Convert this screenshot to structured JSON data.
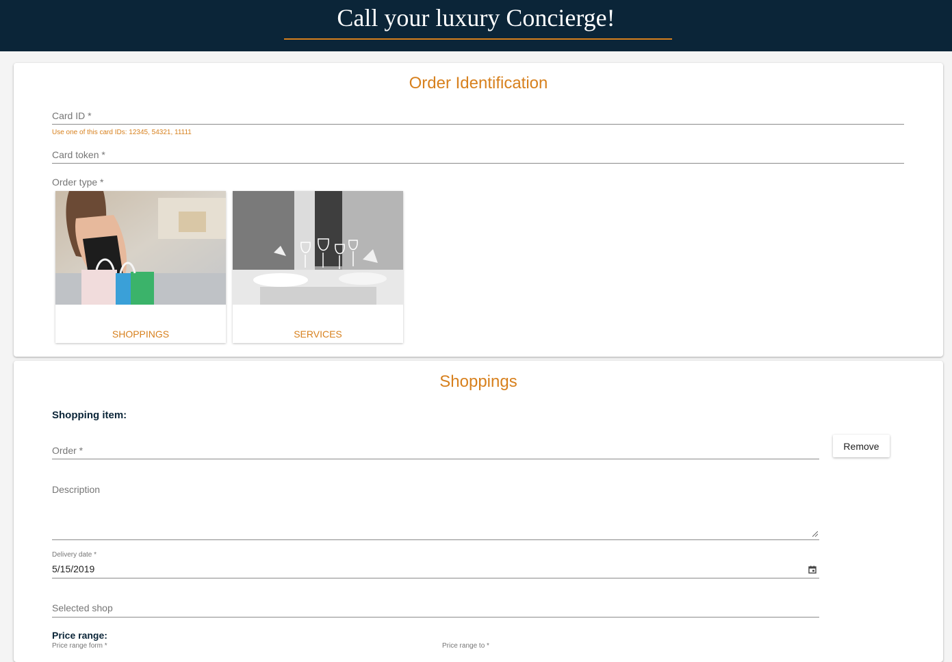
{
  "header": {
    "title": "Call your luxury Concierge!"
  },
  "order_identification": {
    "title": "Order Identification",
    "card_id": {
      "label": "Card ID *",
      "value": "",
      "hint": "Use one of this card IDs: 12345, 54321, 11111"
    },
    "card_token": {
      "label": "Card token *",
      "value": ""
    },
    "order_type": {
      "label": "Order type *",
      "options": [
        {
          "label": "SHOPPINGS",
          "image": "shopping-woman-bags-photo"
        },
        {
          "label": "SERVICES",
          "image": "restaurant-table-photo"
        }
      ]
    }
  },
  "shoppings": {
    "title": "Shoppings",
    "item_heading": "Shopping item:",
    "remove_label": "Remove",
    "order": {
      "label": "Order *",
      "value": ""
    },
    "description": {
      "label": "Description",
      "value": ""
    },
    "delivery_date": {
      "label": "Delivery date *",
      "value": "5/15/2019",
      "icon": "calendar-icon"
    },
    "selected_shop": {
      "label": "Selected shop",
      "value": ""
    },
    "price_range": {
      "heading": "Price range:",
      "from_label": "Price range form *",
      "to_label": "Price range to *"
    }
  },
  "colors": {
    "header_bg": "#0b2538",
    "accent": "#d7801d"
  }
}
